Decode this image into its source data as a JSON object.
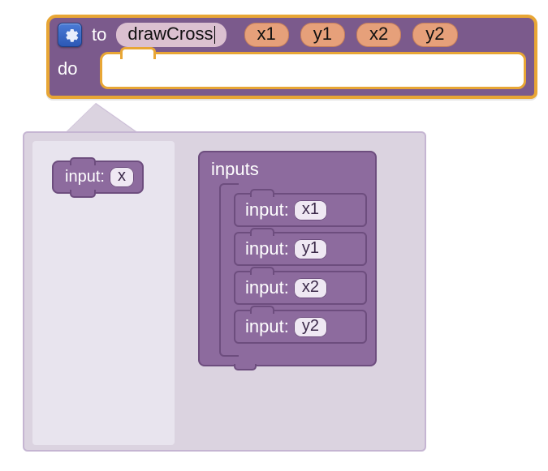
{
  "proc": {
    "to_label": "to",
    "name": "drawCross",
    "params": [
      "x1",
      "y1",
      "x2",
      "y2"
    ],
    "do_label": "do"
  },
  "palette": {
    "input_label": "input:",
    "default_var": "x"
  },
  "mutator": {
    "inputs_label": "inputs",
    "input_label": "input:",
    "items": [
      "x1",
      "y1",
      "x2",
      "y2"
    ]
  },
  "colors": {
    "header": "#7b5a8c",
    "gold": "#e8a635",
    "param": "#e6a07a",
    "mutator": "#8d6b9e",
    "panel": "#dbd3e0"
  }
}
